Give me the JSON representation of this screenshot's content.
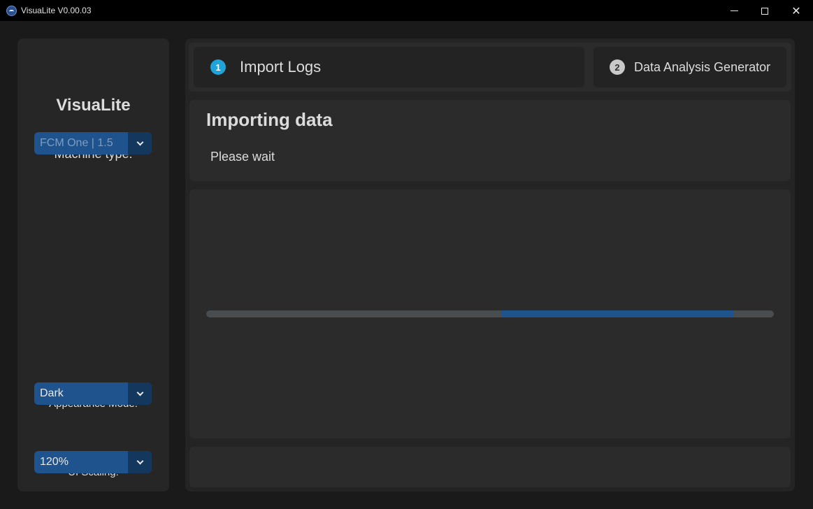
{
  "window": {
    "title": "VisuaLite V0.00.03"
  },
  "sidebar": {
    "brand": "VisuaLite",
    "machine_type": {
      "label": "Machine type:",
      "value": "FCM One | 1.5"
    },
    "appearance_mode": {
      "label": "Appearance Mode:",
      "value": "Dark"
    },
    "ui_scaling": {
      "label": "UI Scaling:",
      "value": "120%"
    }
  },
  "tabs": [
    {
      "step": "1",
      "label": "Import Logs",
      "active": true
    },
    {
      "step": "2",
      "label": "Data Analysis Generator",
      "active": false
    }
  ],
  "status": {
    "title": "Importing data",
    "message": "Please wait"
  },
  "progress": {
    "indeterminate": true,
    "segment_start": 0.52,
    "segment_end": 0.93,
    "color": "#1f538d"
  },
  "colors": {
    "accent": "#1f538d",
    "step_active": "#1fa3d8"
  }
}
